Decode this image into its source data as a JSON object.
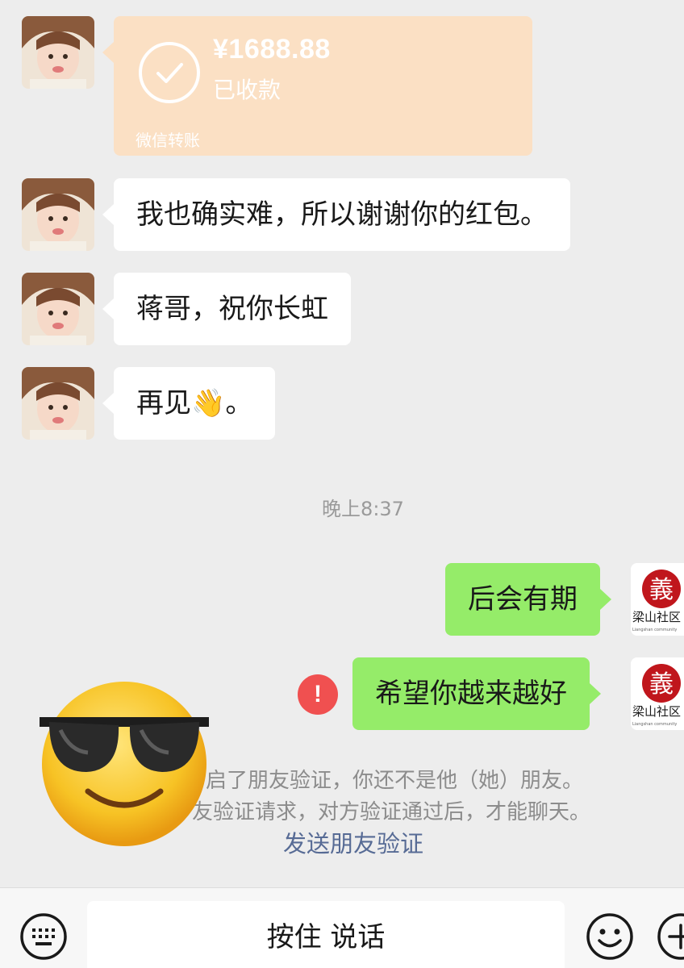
{
  "transfer": {
    "amount": "¥1688.88",
    "status": "已收款",
    "label": "微信转账"
  },
  "messages_left": [
    {
      "text": "我也确实难，所以谢谢你的红包。"
    },
    {
      "text": "蒋哥，祝你长虹"
    },
    {
      "text": "再见👋。"
    }
  ],
  "timestamp": "晚上8:37",
  "messages_right": [
    {
      "text": "后会有期"
    },
    {
      "text": "希望你越来越好"
    }
  ],
  "right_avatar": {
    "glyph": "義",
    "name": "梁山社区",
    "sub": "Liangshan community"
  },
  "error_mark": "!",
  "system_notice": {
    "line1": "启了朋友验证，你还不是他（她）朋友。",
    "line2": "友验证请求，对方验证通过后，才能聊天。",
    "link": "发送朋友验证"
  },
  "bottom_bar": {
    "hold_to_talk": "按住 说话"
  },
  "icons": [
    "check-icon",
    "keyboard-icon",
    "emoji-icon",
    "plus-icon",
    "error-icon"
  ],
  "colors": {
    "background": "#ededed",
    "bubble_left": "#ffffff",
    "bubble_right": "#95ec69",
    "transfer_card": "#fbe0c4",
    "error": "#f05050",
    "link": "#576b95"
  }
}
